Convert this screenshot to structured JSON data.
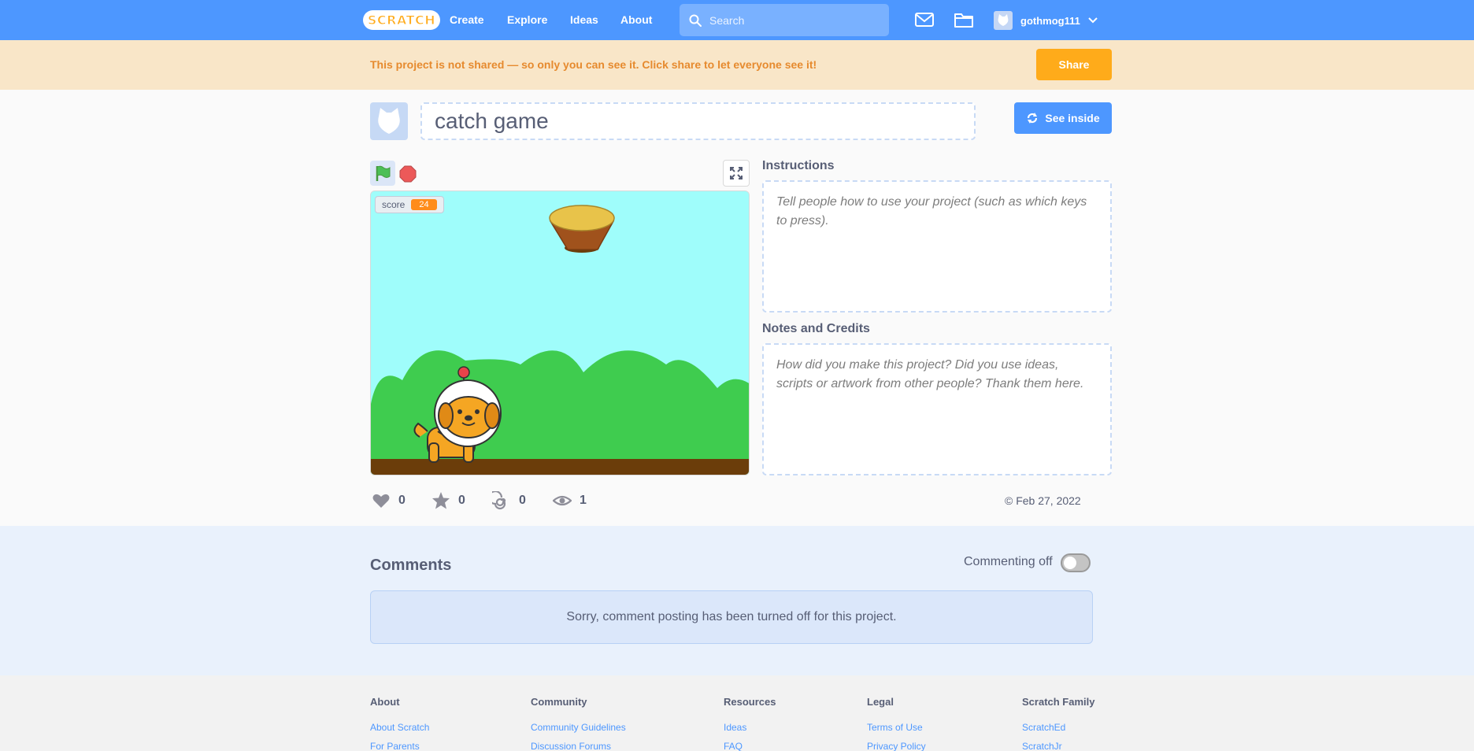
{
  "nav": {
    "logo": "SCRATCH",
    "links": [
      "Create",
      "Explore",
      "Ideas",
      "About"
    ],
    "search_placeholder": "Search",
    "username": "gothmog111"
  },
  "banner": {
    "message": "This project is not shared — so only you can see it. Click share to let everyone see it!",
    "share_label": "Share"
  },
  "project": {
    "title": "catch game",
    "see_inside_label": "See inside"
  },
  "stage": {
    "monitor_label": "score",
    "monitor_value": "24"
  },
  "instructions": {
    "label": "Instructions",
    "placeholder": "Tell people how to use your project (such as which keys to press)."
  },
  "notes": {
    "label": "Notes and Credits",
    "placeholder": "How did you make this project? Did you use ideas, scripts or artwork from other people? Thank them here."
  },
  "stats": {
    "loves": "0",
    "favorites": "0",
    "remixes": "0",
    "views": "1",
    "date": "© Feb 27, 2022"
  },
  "comments": {
    "title": "Comments",
    "toggle_label": "Commenting off",
    "off_message": "Sorry, comment posting has been turned off for this project."
  },
  "footer": {
    "columns": [
      {
        "heading": "About",
        "links": [
          "About Scratch",
          "For Parents"
        ]
      },
      {
        "heading": "Community",
        "links": [
          "Community Guidelines",
          "Discussion Forums"
        ]
      },
      {
        "heading": "Resources",
        "links": [
          "Ideas",
          "FAQ"
        ]
      },
      {
        "heading": "Legal",
        "links": [
          "Terms of Use",
          "Privacy Policy"
        ]
      },
      {
        "heading": "Scratch Family",
        "links": [
          "ScratchEd",
          "ScratchJr"
        ]
      }
    ]
  },
  "colors": {
    "nav_blue": "#4d97ff",
    "share_orange": "#ffab1a",
    "banner_bg": "#f9e6c8",
    "sky": "#9ffdfb",
    "grass": "#3fcc4f",
    "ground": "#6b3d0a"
  }
}
